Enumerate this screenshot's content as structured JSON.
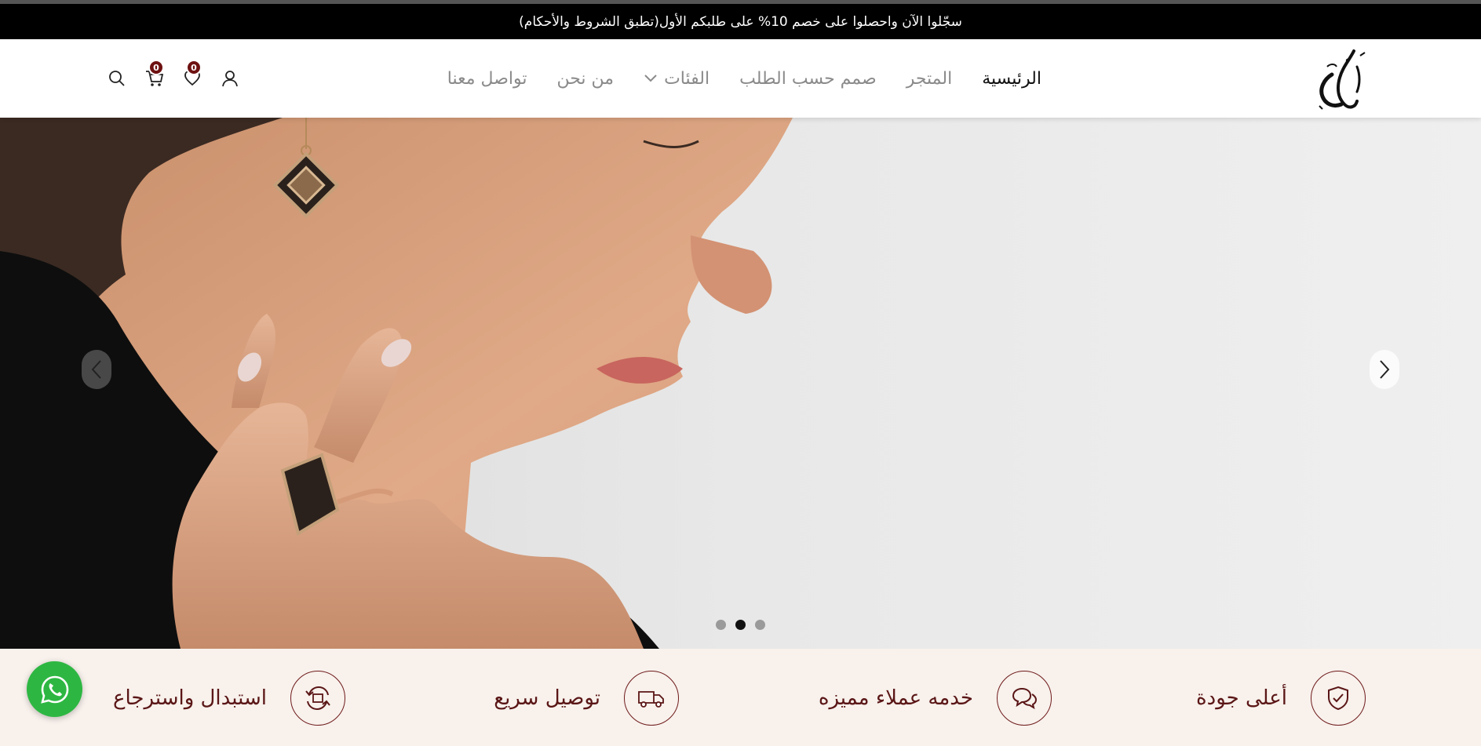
{
  "announcement": {
    "text": "سجّلوا الآن واحصلوا على خصم 10% على طلبكم الأول(تطبق الشروط والأحكام)"
  },
  "header": {
    "logo_text": "غزل",
    "nav": [
      {
        "label": "الرئيسية",
        "active": true
      },
      {
        "label": "المتجر"
      },
      {
        "label": "صمم حسب الطلب"
      },
      {
        "label": "الفئات",
        "has_dropdown": true
      },
      {
        "label": "من نحن"
      },
      {
        "label": "تواصل معنا"
      }
    ],
    "cart_count": "0",
    "wishlist_count": "0",
    "icons": [
      "search-icon",
      "cart-icon",
      "heart-icon",
      "user-icon"
    ]
  },
  "hero": {
    "slides": 3,
    "active_slide": 2
  },
  "features": [
    {
      "label": "أعلى جودة",
      "icon": "shield-check-icon"
    },
    {
      "label": "خدمه عملاء مميزه",
      "icon": "chat-bubbles-icon"
    },
    {
      "label": "توصيل سريع",
      "icon": "truck-icon"
    },
    {
      "label": "استبدال واسترجاع",
      "icon": "exchange-icon"
    }
  ],
  "colors": {
    "accent": "#6e1111",
    "feature_bg": "#f8f1ec",
    "whatsapp": "#2db742",
    "announce_bg": "#000000"
  }
}
